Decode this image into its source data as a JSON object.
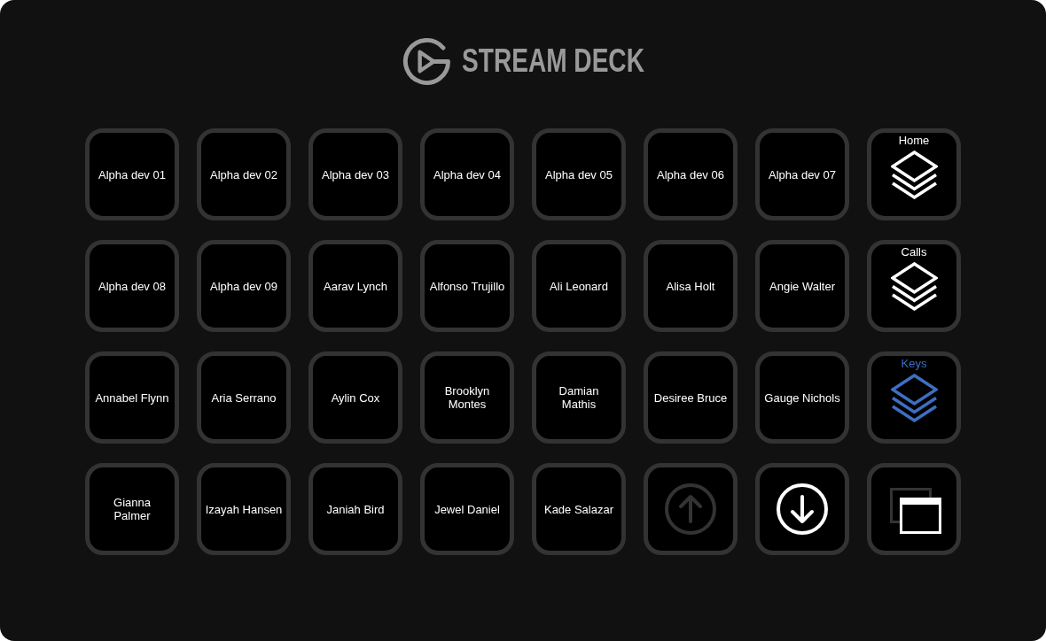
{
  "logo": {
    "text": "STREAM DECK"
  },
  "keys": [
    {
      "kind": "title",
      "title": "Alpha dev 01",
      "selected": false
    },
    {
      "kind": "title",
      "title": "Alpha dev 02",
      "selected": false
    },
    {
      "kind": "title",
      "title": "Alpha dev 03",
      "selected": false
    },
    {
      "kind": "title",
      "title": "Alpha dev 04",
      "selected": false
    },
    {
      "kind": "title",
      "title": "Alpha dev 05",
      "selected": false
    },
    {
      "kind": "title",
      "title": "Alpha dev 06",
      "selected": false
    },
    {
      "kind": "title",
      "title": "Alpha dev 07",
      "selected": false
    },
    {
      "kind": "folder",
      "title": "Home",
      "selected": false
    },
    {
      "kind": "title",
      "title": "Alpha dev 08",
      "selected": false
    },
    {
      "kind": "title",
      "title": "Alpha dev 09",
      "selected": false
    },
    {
      "kind": "title",
      "title": "Aarav Lynch",
      "selected": false
    },
    {
      "kind": "title",
      "title": "Alfonso Trujillo",
      "selected": false
    },
    {
      "kind": "title",
      "title": "Ali Leonard",
      "selected": false
    },
    {
      "kind": "title",
      "title": "Alisa Holt",
      "selected": false
    },
    {
      "kind": "title",
      "title": "Angie Walter",
      "selected": false
    },
    {
      "kind": "folder",
      "title": "Calls",
      "selected": false
    },
    {
      "kind": "title",
      "title": "Annabel Flynn",
      "selected": false
    },
    {
      "kind": "title",
      "title": "Aria Serrano",
      "selected": false
    },
    {
      "kind": "title",
      "title": "Aylin Cox",
      "selected": false
    },
    {
      "kind": "title",
      "title": "Brooklyn\nMontes",
      "selected": false
    },
    {
      "kind": "title",
      "title": "Damian\nMathis",
      "selected": false
    },
    {
      "kind": "title",
      "title": "Desiree Bruce",
      "selected": false
    },
    {
      "kind": "title",
      "title": "Gauge Nichols",
      "selected": false
    },
    {
      "kind": "folder",
      "title": "Keys",
      "selected": true
    },
    {
      "kind": "title",
      "title": "Gianna\nPalmer",
      "selected": false
    },
    {
      "kind": "title",
      "title": "Izayah Hansen",
      "selected": false
    },
    {
      "kind": "title",
      "title": "Janiah Bird",
      "selected": false
    },
    {
      "kind": "title",
      "title": "Jewel Daniel",
      "selected": false
    },
    {
      "kind": "title",
      "title": "Kade Salazar",
      "selected": false
    },
    {
      "kind": "page_up",
      "disabled": true,
      "selected": false
    },
    {
      "kind": "page_down",
      "disabled": false,
      "selected": false
    },
    {
      "kind": "switch_window",
      "selected": false
    }
  ]
}
